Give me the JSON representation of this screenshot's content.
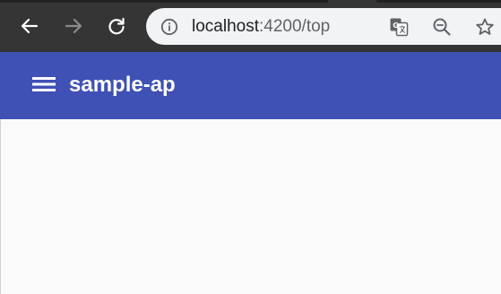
{
  "browser": {
    "url_host": "localhost",
    "url_path": ":4200/top",
    "icons": {
      "back": "back-arrow-icon",
      "forward": "forward-arrow-icon",
      "reload": "reload-icon",
      "info": "info-icon",
      "translate": "translate-icon",
      "zoom": "zoom-out-icon",
      "bookmark": "star-icon"
    }
  },
  "app": {
    "title": "sample-ap",
    "menu_icon": "menu-icon",
    "toolbar_color": "#3f51b5"
  }
}
